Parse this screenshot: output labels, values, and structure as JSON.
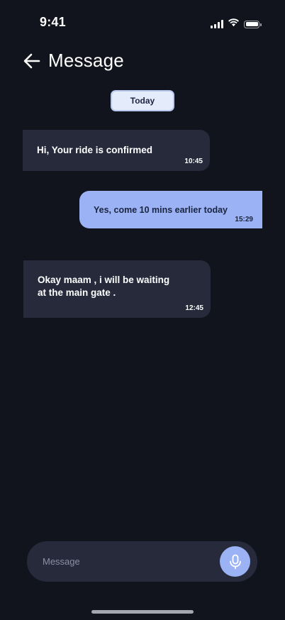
{
  "status_bar": {
    "time": "9:41",
    "icons": [
      "cellular-signal-icon",
      "wifi-icon",
      "battery-icon"
    ]
  },
  "header": {
    "back_icon": "arrow-left-icon",
    "title": "Message"
  },
  "date_divider": "Today",
  "messages": [
    {
      "direction": "incoming",
      "text": "Hi, Your ride is confirmed",
      "time": "10:45"
    },
    {
      "direction": "outgoing",
      "text": "Yes, come 10 mins earlier today",
      "time": "15:29"
    },
    {
      "direction": "incoming",
      "text": "Okay maam ,  i will be waiting\nat the main gate .",
      "time": "12:45"
    }
  ],
  "composer": {
    "placeholder": "Message",
    "value": "",
    "mic_icon": "microphone-icon"
  },
  "colors": {
    "background": "#12141d",
    "incoming_bubble": "#262a3b",
    "outgoing_bubble": "#9bb3f4",
    "accent": "#9bb3f4",
    "date_badge": "#e4ebfb"
  }
}
